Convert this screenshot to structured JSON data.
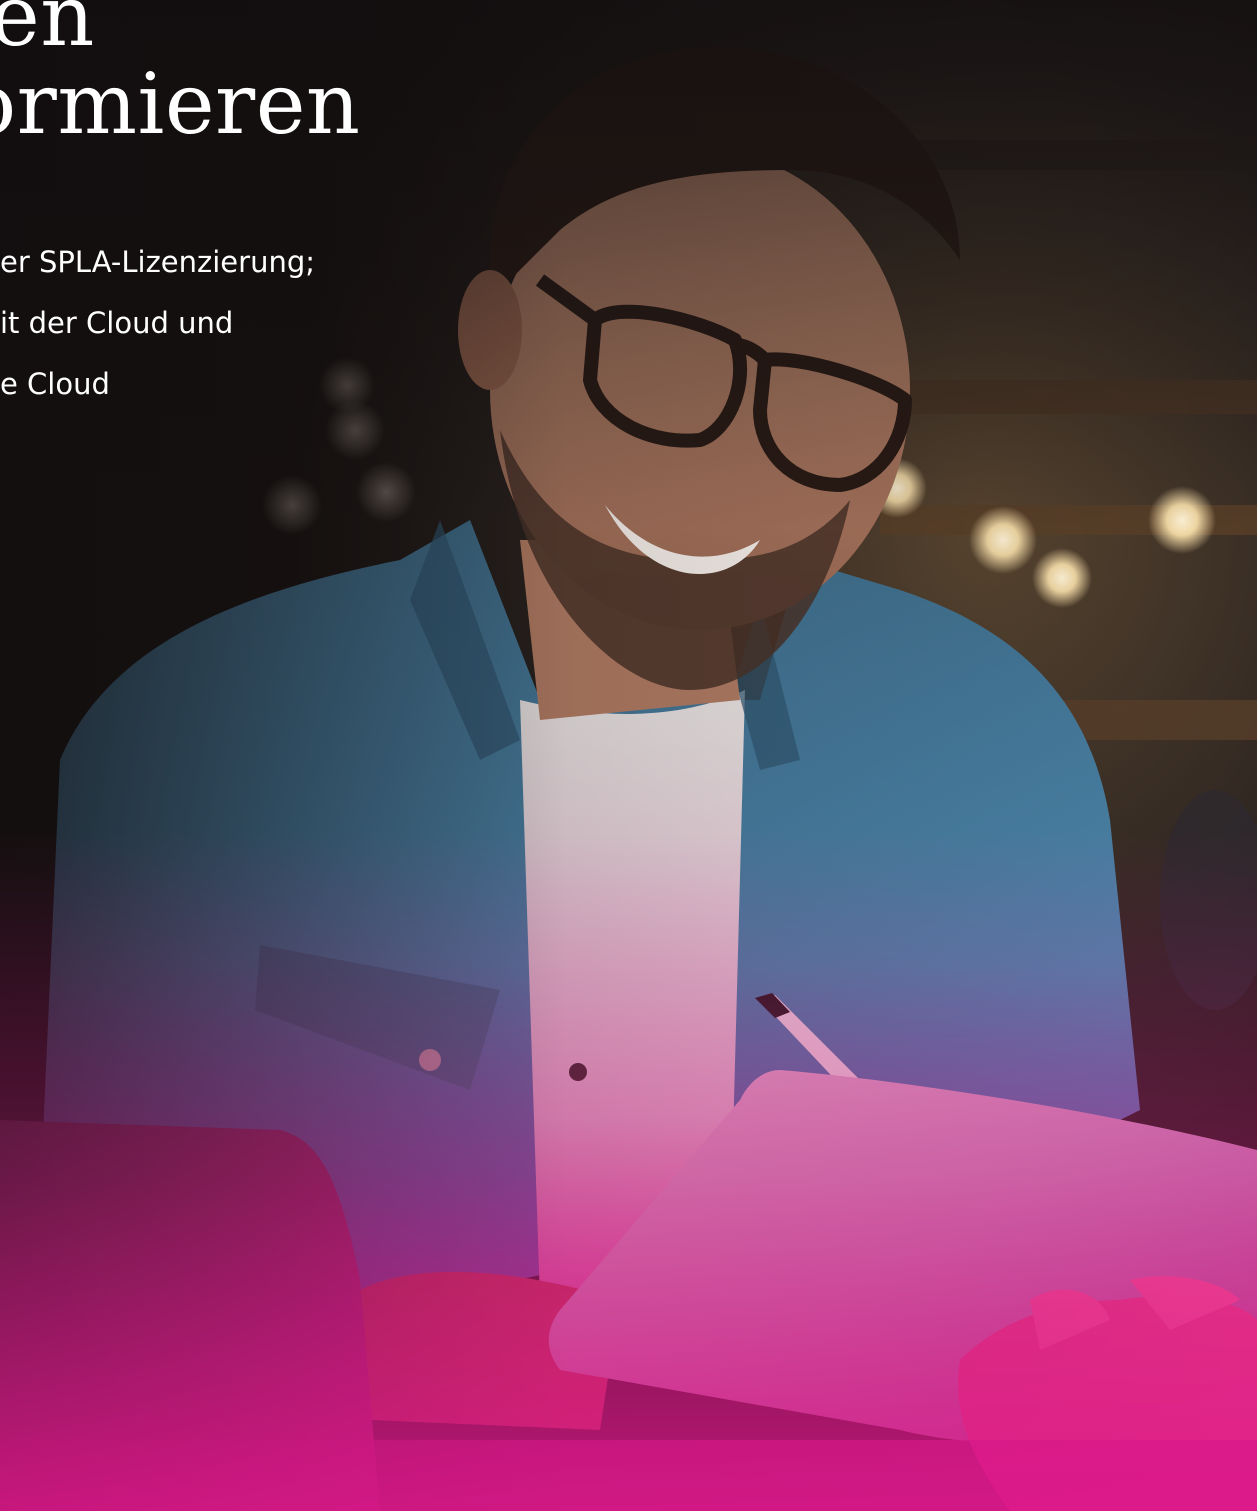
{
  "hero": {
    "headline_line1": "en",
    "headline_line2": "formieren",
    "lead_line1": "er SPLA-Lizenzierung;",
    "lead_line2": "it der Cloud und",
    "lead_line3": "e Cloud"
  },
  "colors": {
    "text": "#ffffff",
    "overlay_top": "#1a1516",
    "overlay_bottom": "#e0188c",
    "shirt": "#4a7fa3"
  }
}
